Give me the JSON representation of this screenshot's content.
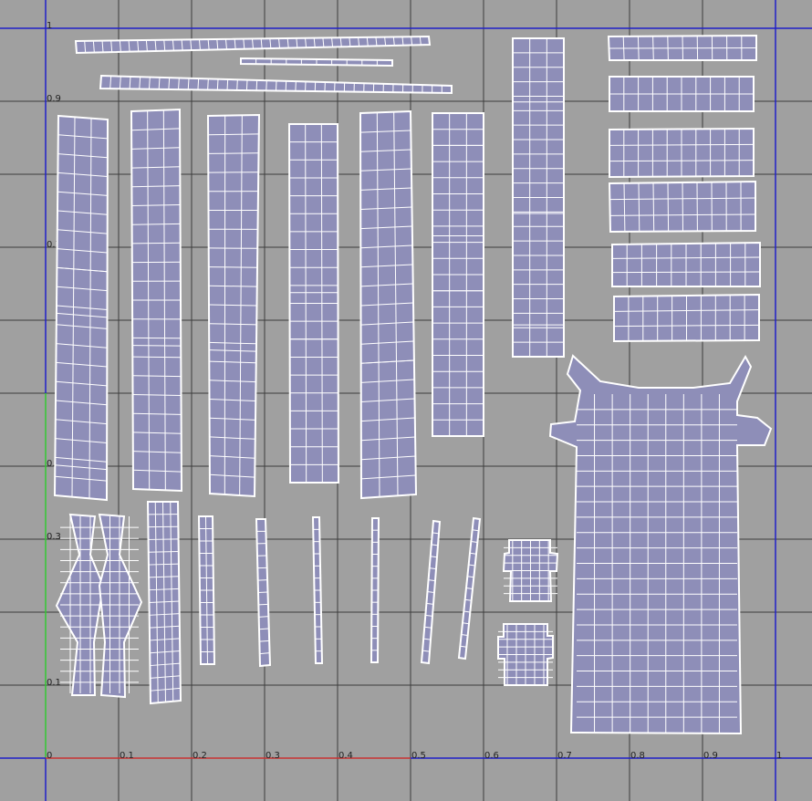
{
  "app": {
    "view": "UV Texture Editor"
  },
  "colors": {
    "background": "#a0a0a0",
    "grid": "#3c3c3c",
    "shell_fill": "#8e8eb8",
    "wireframe": "#ffffff",
    "u_axis": "#c83232",
    "v_axis": "#32c832",
    "border_axis": "#2020c8"
  },
  "axis": {
    "u_ticks": [
      "0",
      "0.1",
      "0.2",
      "0.3",
      "0.4",
      "0.5",
      "0.6",
      "0.7",
      "0.8",
      "0.9",
      "1"
    ],
    "v_ticks": [
      "0.1",
      "0.3",
      "0.5",
      "0.7",
      "0.9",
      "1"
    ]
  },
  "uv_shells": [
    {
      "name": "thin-strip-top-1",
      "kind": "strip"
    },
    {
      "name": "thin-strip-top-2",
      "kind": "strip"
    },
    {
      "name": "thin-strip-top-3",
      "kind": "strip"
    },
    {
      "name": "tall-panel-1",
      "kind": "panel"
    },
    {
      "name": "tall-panel-2",
      "kind": "panel"
    },
    {
      "name": "tall-panel-3",
      "kind": "panel"
    },
    {
      "name": "tall-panel-4",
      "kind": "panel"
    },
    {
      "name": "tall-panel-5",
      "kind": "panel"
    },
    {
      "name": "ladder-shell-1",
      "kind": "ladder"
    },
    {
      "name": "ladder-shell-2",
      "kind": "ladder"
    },
    {
      "name": "horizontal-panel-1",
      "kind": "panel"
    },
    {
      "name": "horizontal-panel-2",
      "kind": "panel"
    },
    {
      "name": "horizontal-panel-3",
      "kind": "panel"
    },
    {
      "name": "horizontal-panel-4",
      "kind": "panel"
    },
    {
      "name": "horizontal-panel-5",
      "kind": "panel"
    },
    {
      "name": "horizontal-panel-6",
      "kind": "panel"
    },
    {
      "name": "body-shell",
      "kind": "body"
    },
    {
      "name": "vase-shell-1",
      "kind": "vase"
    },
    {
      "name": "vase-shell-2",
      "kind": "vase"
    },
    {
      "name": "column-shell",
      "kind": "column"
    },
    {
      "name": "thin-vertical-strip-1",
      "kind": "strip"
    },
    {
      "name": "thin-vertical-strip-2",
      "kind": "strip"
    },
    {
      "name": "thin-vertical-strip-3",
      "kind": "strip"
    },
    {
      "name": "thin-vertical-strip-4",
      "kind": "strip"
    },
    {
      "name": "thin-vertical-strip-5",
      "kind": "strip"
    },
    {
      "name": "thin-vertical-strip-6",
      "kind": "strip"
    },
    {
      "name": "small-box-shell-1",
      "kind": "box"
    },
    {
      "name": "small-box-shell-2",
      "kind": "box"
    }
  ]
}
